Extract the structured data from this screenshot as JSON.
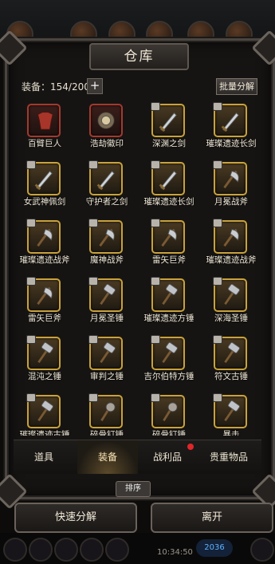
{
  "title": "仓库",
  "capacity": {
    "label": "装备：154/200",
    "plus": "+"
  },
  "batch_label": "批量分解",
  "items": [
    {
      "name": "百臂巨人",
      "icon": "armor-icon",
      "locked": false,
      "frame": "red"
    },
    {
      "name": "浩劫徽印",
      "icon": "emblem-icon",
      "locked": false,
      "frame": "red"
    },
    {
      "name": "深渊之剑",
      "icon": "sword-icon",
      "locked": true,
      "frame": "gold"
    },
    {
      "name": "璀璨遗迹长剑",
      "icon": "sword-icon",
      "locked": true,
      "frame": "gold"
    },
    {
      "name": "女武神佩剑",
      "icon": "sword-icon",
      "locked": true,
      "frame": "gold"
    },
    {
      "name": "守护者之剑",
      "icon": "sword-icon",
      "locked": true,
      "frame": "gold"
    },
    {
      "name": "璀璨遗迹长剑",
      "icon": "sword-icon",
      "locked": true,
      "frame": "gold"
    },
    {
      "name": "月冕战斧",
      "icon": "axe-icon",
      "locked": true,
      "frame": "gold"
    },
    {
      "name": "璀璨遗迹战斧",
      "icon": "axe-icon",
      "locked": true,
      "frame": "gold"
    },
    {
      "name": "魔神战斧",
      "icon": "axe-icon",
      "locked": true,
      "frame": "gold"
    },
    {
      "name": "雷矢巨斧",
      "icon": "axe-icon",
      "locked": true,
      "frame": "gold"
    },
    {
      "name": "璀璨遗迹战斧",
      "icon": "axe-icon",
      "locked": true,
      "frame": "gold"
    },
    {
      "name": "雷矢巨斧",
      "icon": "axe-icon",
      "locked": true,
      "frame": "gold"
    },
    {
      "name": "月冕圣锤",
      "icon": "hammer-icon",
      "locked": true,
      "frame": "gold"
    },
    {
      "name": "璀璨遗迹方锤",
      "icon": "hammer-icon",
      "locked": true,
      "frame": "gold"
    },
    {
      "name": "深海圣锤",
      "icon": "hammer-icon",
      "locked": true,
      "frame": "gold"
    },
    {
      "name": "混沌之锤",
      "icon": "hammer-icon",
      "locked": true,
      "frame": "gold"
    },
    {
      "name": "审判之锤",
      "icon": "hammer-icon",
      "locked": true,
      "frame": "gold"
    },
    {
      "name": "吉尔伯特方锤",
      "icon": "hammer-icon",
      "locked": true,
      "frame": "gold"
    },
    {
      "name": "符文古锤",
      "icon": "hammer-icon",
      "locked": true,
      "frame": "gold"
    },
    {
      "name": "璀璨遗迹古锤",
      "icon": "hammer-icon",
      "locked": true,
      "frame": "gold"
    },
    {
      "name": "碎骨钉锤",
      "icon": "mace-icon",
      "locked": true,
      "frame": "gold"
    },
    {
      "name": "碎骨钉锤",
      "icon": "mace-icon",
      "locked": true,
      "frame": "gold"
    },
    {
      "name": "暴击",
      "icon": "hammer-icon",
      "locked": true,
      "frame": "gold"
    }
  ],
  "tabs": [
    {
      "label": "道具",
      "active": false
    },
    {
      "label": "装备",
      "active": true
    },
    {
      "label": "战利品",
      "active": false,
      "dot": true
    },
    {
      "label": "贵重物品",
      "active": false
    }
  ],
  "sort_label": "排序",
  "quick_decompose_label": "快速分解",
  "leave_label": "离开",
  "clock": "10:34:50",
  "gem_count": "2036",
  "colors": {
    "gold_frame": "#c9a23a",
    "red_frame": "#a23a2e",
    "red_dot": "#e0262a"
  }
}
